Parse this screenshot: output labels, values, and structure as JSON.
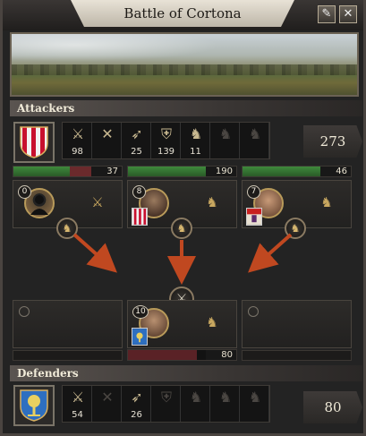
{
  "window": {
    "title": "Battle of Cortona",
    "pin_label": "✎",
    "close_label": "✕"
  },
  "sections": {
    "attackers": "Attackers",
    "defenders": "Defenders"
  },
  "attackers": {
    "total": "273",
    "units": [
      {
        "icon": "light-infantry-icon",
        "glyph": "⚔",
        "value": "98",
        "active": true
      },
      {
        "icon": "pikemen-icon",
        "glyph": "✕",
        "value": "",
        "active": true
      },
      {
        "icon": "archers-icon",
        "glyph": "➶",
        "value": "25",
        "active": true
      },
      {
        "icon": "heavy-infantry-icon",
        "glyph": "⛨",
        "value": "139",
        "active": true
      },
      {
        "icon": "light-cavalry-icon",
        "glyph": "♞",
        "value": "11",
        "active": true
      },
      {
        "icon": "knights-icon",
        "glyph": "♞",
        "value": "",
        "active": false
      },
      {
        "icon": "horse-archers-icon",
        "glyph": "♞",
        "value": "",
        "active": false
      }
    ],
    "flanks": [
      {
        "name": "left",
        "value": "37",
        "level": "0",
        "fill": 0.72,
        "color": "#3f8a3c"
      },
      {
        "name": "center",
        "value": "190",
        "level": "8",
        "fill": 1.0,
        "color": "#3f8a3c"
      },
      {
        "name": "right",
        "value": "46",
        "level": "7",
        "fill": 1.0,
        "color": "#3f8a3c"
      }
    ]
  },
  "defenders": {
    "total": "80",
    "units": [
      {
        "icon": "light-infantry-icon",
        "glyph": "⚔",
        "value": "54",
        "active": true
      },
      {
        "icon": "pikemen-icon",
        "glyph": "✕",
        "value": "",
        "active": false
      },
      {
        "icon": "archers-icon",
        "glyph": "➶",
        "value": "26",
        "active": true
      },
      {
        "icon": "heavy-infantry-icon",
        "glyph": "⛨",
        "value": "",
        "active": false
      },
      {
        "icon": "light-cavalry-icon",
        "glyph": "♞",
        "value": "",
        "active": false
      },
      {
        "icon": "knights-icon",
        "glyph": "♞",
        "value": "",
        "active": false
      },
      {
        "icon": "horse-archers-icon",
        "glyph": "♞",
        "value": "",
        "active": false
      }
    ],
    "center": {
      "level": "10",
      "value": "80",
      "fill": 0.88,
      "color": "#5a2226"
    }
  },
  "colors": {
    "attacker_shield": "#c8102e",
    "defender_shield": "#2e6fc0",
    "arrow": "#c04820"
  }
}
